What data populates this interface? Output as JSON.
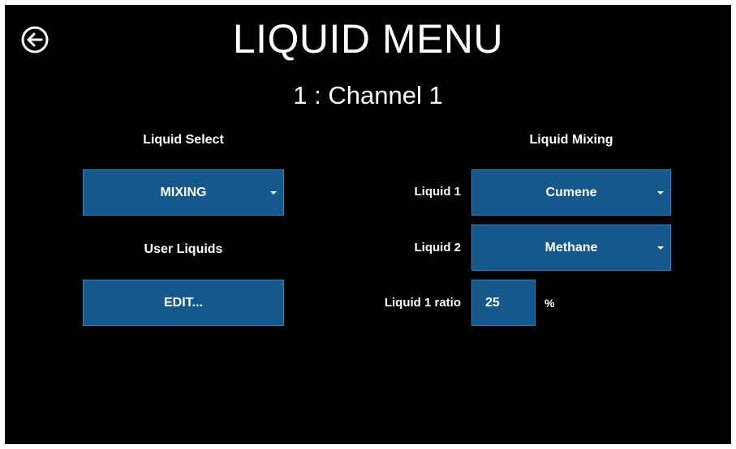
{
  "header": {
    "title": "LIQUID MENU",
    "subtitle": "1 : Channel 1",
    "back_icon": "arrow-left-circle-icon"
  },
  "liquid_select": {
    "label": "Liquid Select",
    "value": "MIXING"
  },
  "user_liquids": {
    "label": "User Liquids",
    "button_label": "EDIT..."
  },
  "liquid_mixing": {
    "label": "Liquid Mixing",
    "liquid1_label": "Liquid 1",
    "liquid1_value": "Cumene",
    "liquid2_label": "Liquid 2",
    "liquid2_value": "Methane",
    "ratio_label": "Liquid 1 ratio",
    "ratio_value": "25",
    "ratio_unit": "%"
  },
  "colors": {
    "background": "#000000",
    "button_fill": "#14588c",
    "button_border": "#2f86c4",
    "text": "#ffffff"
  }
}
